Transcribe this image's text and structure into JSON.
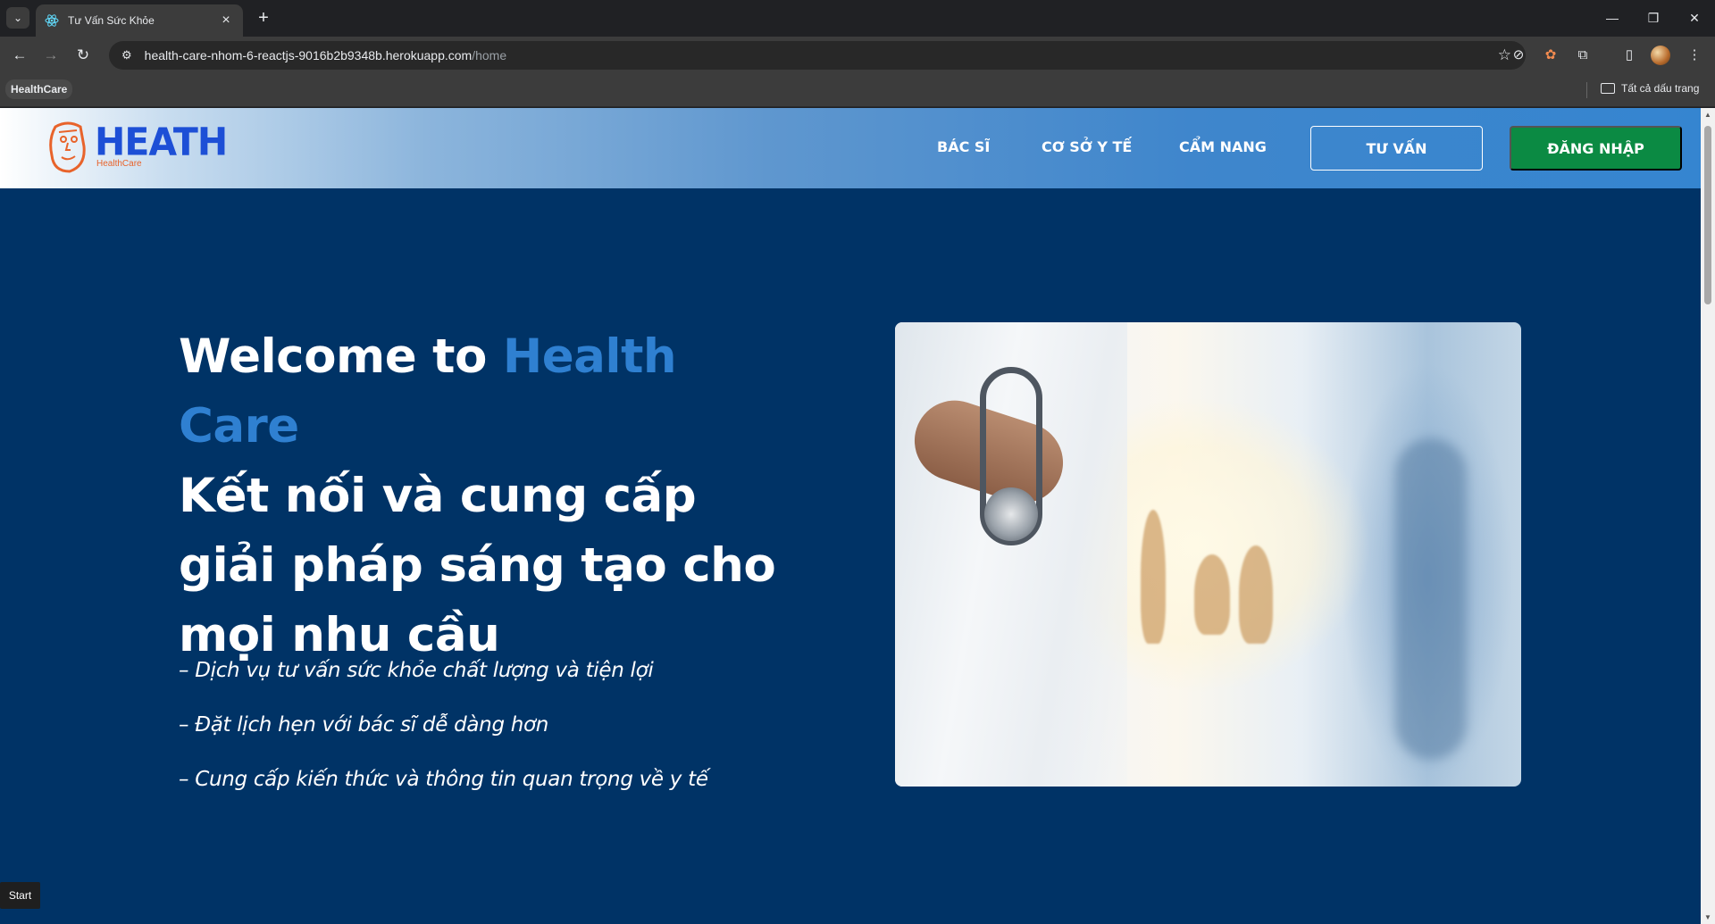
{
  "browser": {
    "tab_title": "Tư Vấn Sức Khỏe",
    "url_host": "health-care-nhom-6-reactjs-9016b2b9348b.herokuapp.com",
    "url_path": "/home",
    "bookmark": "HealthCare",
    "all_bookmarks": "Tất cả dấu trang"
  },
  "header": {
    "logo_title": "HEATH",
    "logo_sub": "HealthCare",
    "nav": [
      "BÁC SĨ",
      "CƠ SỞ Y TẾ",
      "CẨM NANG"
    ],
    "consult_button": "TƯ VẤN",
    "login_button": "ĐĂNG NHẬP"
  },
  "hero": {
    "welcome": "Welcome to ",
    "brand": "Health Care",
    "tagline": "Kết nối và cung cấp giải pháp sáng tạo cho mọi nhu cầu",
    "bullets": [
      "– Dịch vụ tư vấn sức khỏe chất lượng và tiện lợi",
      "– Đặt lịch hẹn với bác sĩ dễ dàng hơn",
      "– Cung cấp kiến thức và thông tin quan trọng về y tế"
    ]
  },
  "start_button": "Start",
  "colors": {
    "page_bg": "#003366",
    "accent": "#2f80d1",
    "login_bg": "#0b8a43",
    "logo_blue": "#1d4fd6",
    "logo_orange": "#e8632b"
  }
}
